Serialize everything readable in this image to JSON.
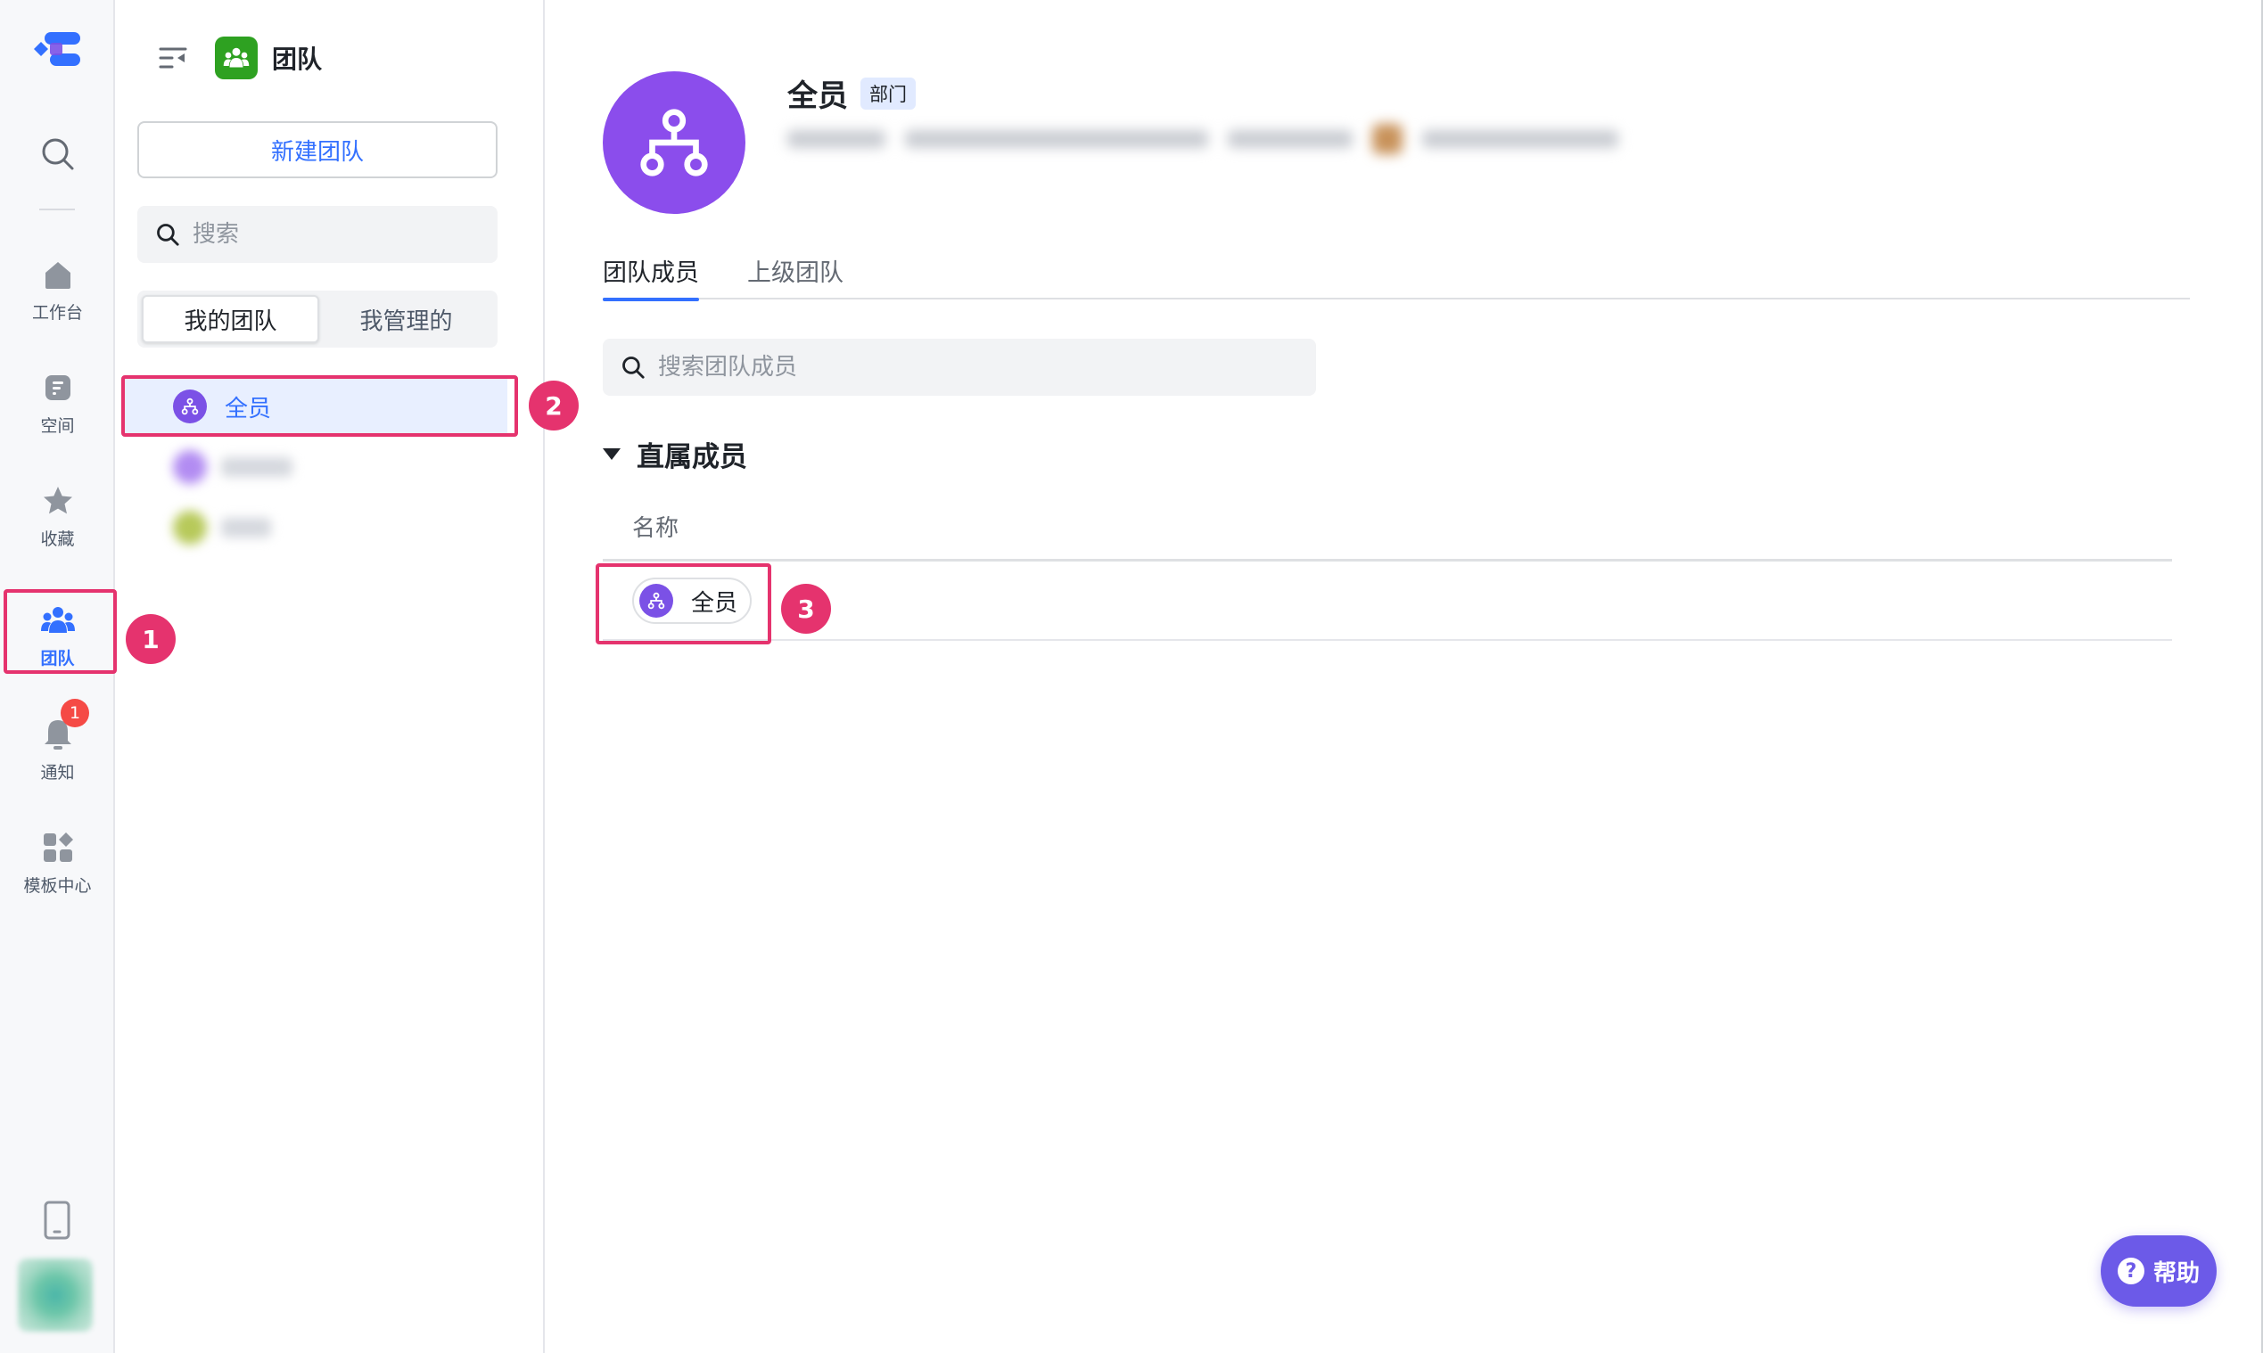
{
  "nav": {
    "items": [
      {
        "label": "工作台",
        "icon": "home-icon"
      },
      {
        "label": "空间",
        "icon": "space-icon"
      },
      {
        "label": "收藏",
        "icon": "star-icon"
      },
      {
        "label": "团队",
        "icon": "team-icon",
        "active": true
      },
      {
        "label": "通知",
        "icon": "bell-icon",
        "badge": "1"
      },
      {
        "label": "模板中心",
        "icon": "template-icon"
      }
    ]
  },
  "sidebar": {
    "title": "团队",
    "new_team_label": "新建团队",
    "search_placeholder": "搜索",
    "segments": [
      "我的团队",
      "我管理的"
    ],
    "active_segment": "我的团队",
    "teams": [
      {
        "name": "全员",
        "active": true
      }
    ]
  },
  "main": {
    "team_name": "全员",
    "team_tag": "部门",
    "tabs": [
      "团队成员",
      "上级团队"
    ],
    "active_tab": "团队成员",
    "member_search_placeholder": "搜索团队成员",
    "section_title": "直属成员",
    "column_name": "名称",
    "members": [
      {
        "name": "全员"
      }
    ]
  },
  "annotations": [
    "1",
    "2",
    "3"
  ],
  "help_label": "帮助",
  "colors": {
    "accent": "#3370ff",
    "annotation": "#e5336e",
    "department": "#8b4dec",
    "team_app": "#2ea121",
    "help": "#6c5ae8"
  }
}
